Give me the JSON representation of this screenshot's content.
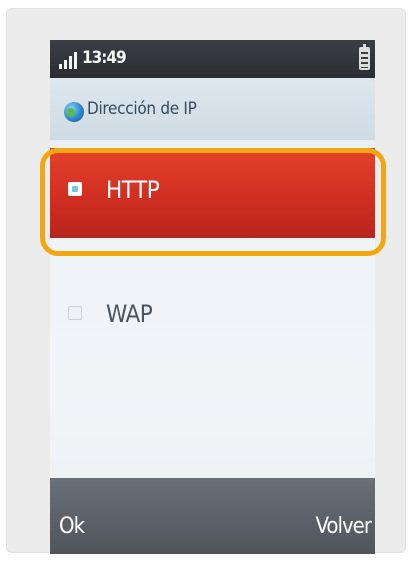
{
  "status_bar": {
    "time": "13:49",
    "signal_icon": "signal-bars-icon",
    "battery_icon": "battery-icon"
  },
  "header": {
    "icon": "globe-icon",
    "title": "Dirección de IP"
  },
  "options": [
    {
      "label": "HTTP",
      "selected": true
    },
    {
      "label": "WAP",
      "selected": false
    }
  ],
  "softkeys": {
    "left": "Ok",
    "right": "Volver"
  },
  "colors": {
    "selected_row": "#d12f22",
    "highlight_ring": "#f2a712",
    "softkey_bar": "#5a6068"
  }
}
